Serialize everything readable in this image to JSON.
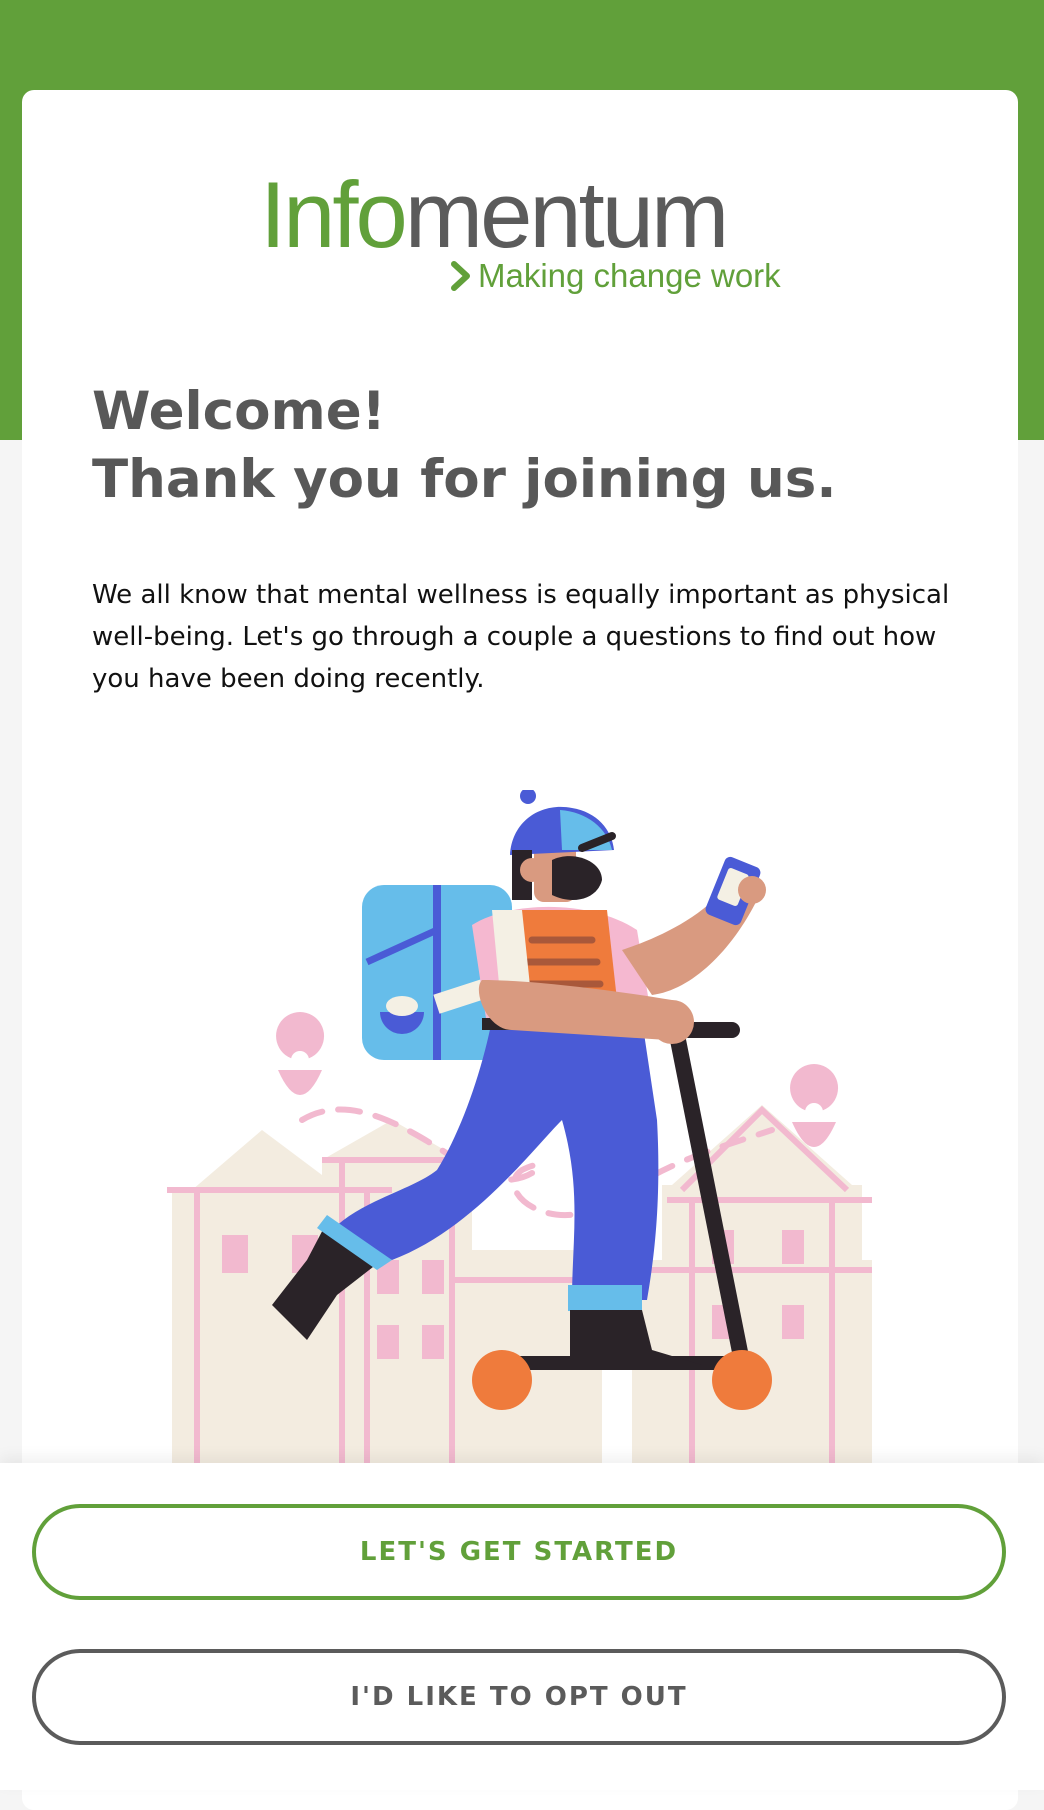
{
  "brand": {
    "logo_part_1": "Info",
    "logo_part_2": "mentum",
    "tagline": "Making change work",
    "accent_color": "#61a03a",
    "text_gray": "#5b5b5b"
  },
  "welcome": {
    "line1": "Welcome!",
    "line2": "Thank you for joining us.",
    "body": "We all know that mental wellness is equally important as physical well-being. Let's go through a couple a questions to find out how you have been doing recently."
  },
  "illustration": {
    "subject": "delivery rider on scooter with backpack, phone, pink town and location pins"
  },
  "actions": {
    "start_label": "LET'S GET STARTED",
    "opt_out_label": "I'D LIKE TO OPT OUT"
  }
}
